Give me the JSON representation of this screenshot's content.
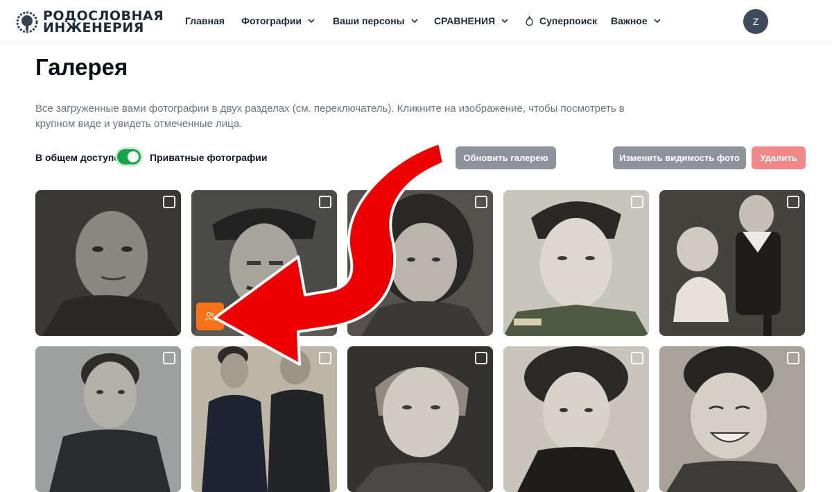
{
  "header": {
    "logo": {
      "line1": "РОДОСЛОВНАЯ",
      "line2": "ИНЖЕНЕРИЯ"
    },
    "nav": [
      {
        "label": "Главная"
      },
      {
        "label": "Фотографии"
      },
      {
        "label": "Ваши персоны"
      },
      {
        "label": "СРАВНЕНИЯ"
      },
      {
        "label": "Суперпоиск"
      },
      {
        "label": "Важное"
      }
    ],
    "avatar_initial": "Z"
  },
  "page": {
    "title": "Галерея",
    "description": "Все загруженные вами фотографии в двух разделах (см. переключатель). Кликните на изображение, чтобы посмотреть в крупном виде и увидеть отмеченные лица."
  },
  "controls": {
    "public_label": "В общем доступе",
    "private_label": "Приватные фотографии",
    "refresh_button": "Обновить галерею",
    "visibility_button": "Изменить видимость фото",
    "delete_button": "Удалить"
  },
  "colors": {
    "toggle_on": "#16a34a",
    "badge": "#f97316",
    "delete": "#f0888a",
    "secondary_button": "#8c939c",
    "annotation_arrow": "#ee0000"
  },
  "gallery": {
    "photos": [
      {
        "name": "portrait-man-1",
        "has_faces_badge": false
      },
      {
        "name": "portrait-man-cap",
        "has_faces_badge": true
      },
      {
        "name": "portrait-child",
        "has_faces_badge": false
      },
      {
        "name": "portrait-soldier",
        "has_faces_badge": false
      },
      {
        "name": "portrait-two-children",
        "has_faces_badge": false
      },
      {
        "name": "portrait-woman-1",
        "has_faces_badge": false
      },
      {
        "name": "portrait-couple",
        "has_faces_badge": false
      },
      {
        "name": "portrait-young-woman",
        "has_faces_badge": false
      },
      {
        "name": "portrait-woman-2",
        "has_faces_badge": false
      },
      {
        "name": "portrait-smiling-boy",
        "has_faces_badge": false
      }
    ]
  },
  "icons": {
    "logo": "tree-logo-icon",
    "chevron": "chevron-down-icon",
    "superpoisk": "flame-icon",
    "checkbox": "checkbox-icon",
    "faces": "people-icon"
  }
}
